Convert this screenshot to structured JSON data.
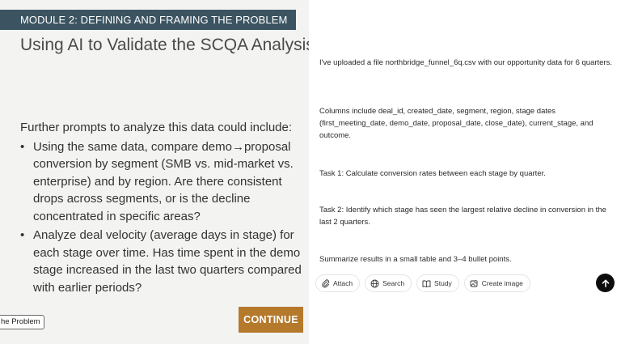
{
  "slide": {
    "module_banner": "MODULE 2: DEFINING AND FRAMING THE PROBLEM",
    "title": "Using AI to Validate the SCQA Analysis",
    "intro": "Further prompts to analyze this data could include:",
    "bullets": [
      "Using the same data, compare demo→proposal conversion by segment (SMB vs. mid-market vs. enterprise) and by region. Are there consistent drops across segments, or is the decline concentrated in specific areas?",
      "Analyze deal velocity (average days in stage) for each stage over time. Has time spent in the demo stage increased in the last two quarters compared with earlier periods?"
    ],
    "continue_label": "CONTINUE",
    "nav_chip_label": "he Problem"
  },
  "chat": {
    "paragraphs": [
      "I've uploaded a file northbridge_funnel_6q.csv with our opportunity data for 6 quarters.",
      "Columns include deal_id, created_date, segment, region, stage dates (first_meeting_date, demo_date, proposal_date, close_date), current_stage, and outcome.",
      "Task 1: Calculate conversion rates between each stage by quarter.",
      "Task 2: Identify which stage has seen the largest relative decline in conversion in the last 2 quarters.",
      "Summarize results in a small table and 3–4 bullet points."
    ],
    "tools": {
      "attach": "Attach",
      "search": "Search",
      "study": "Study",
      "create_image": "Create image"
    }
  },
  "colors": {
    "banner": "#3c5461",
    "continue": "#b5792c",
    "send": "#0d0d0d"
  },
  "icons": [
    "paperclip-icon",
    "globe-icon",
    "book-icon",
    "image-icon",
    "arrow-up-icon"
  ]
}
